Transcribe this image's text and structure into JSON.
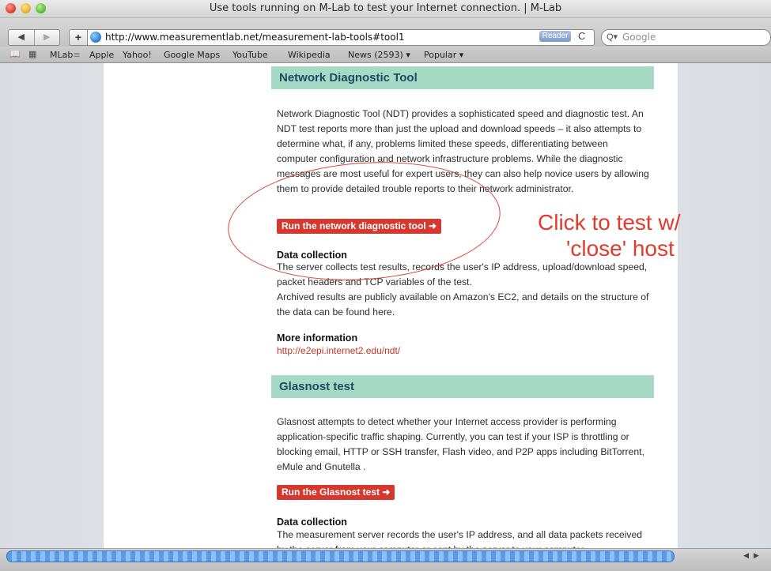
{
  "window": {
    "title": "Use tools running on M-Lab to test your Internet connection. | M-Lab"
  },
  "toolbar": {
    "back_icon": "◀",
    "forward_icon": "▶",
    "add_icon": "+",
    "url": "http://www.measurementlab.net/measurement-lab-tools#tool1",
    "reader_label": "Reader",
    "reload_icon": "C",
    "search_icon": "Q▾",
    "search_placeholder": "Google"
  },
  "bookmarks": {
    "items": [
      "MLab",
      "Apple",
      "Yahoo!",
      "Google Maps",
      "YouTube",
      "Wikipedia",
      "News (2593)",
      "Popular"
    ],
    "mlab_sep": "≡",
    "news_suffix": "▾",
    "popular_suffix": "▾"
  },
  "ndt": {
    "heading": "Network Diagnostic Tool",
    "paragraph": "Network Diagnostic Tool (NDT) provides a sophisticated speed and diagnostic test. An NDT test reports more than just the upload and download speeds – it also attempts to determine what, if any, problems limited these speeds, differentiating between computer configuration and network infrastructure problems. While the diagnostic messages are most useful for expert users, they can also help novice users by allowing them to provide detailed trouble reports to their network administrator.",
    "button": "Run the network diagnostic tool ➜",
    "data_collection_heading": "Data collection",
    "data_collection_text": "The server collects test results, records the user's IP address, upload/download speed, packet headers and TCP variables of the test.",
    "archive_text": "Archived results are publicly available on Amazon's EC2, and details on the structure of the data can be found here.",
    "more_info_heading": "More information",
    "more_info_link": "http://e2epi.internet2.edu/ndt/"
  },
  "glasnost": {
    "heading": "Glasnost test",
    "paragraph": "Glasnost attempts to detect whether your Internet access provider is performing application-specific traffic shaping. Currently, you can test if your ISP is throttling or blocking email, HTTP or SSH transfer, Flash video, and P2P apps including BitTorrent, eMule and Gnutella .",
    "button": "Run the Glasnost test ➜",
    "data_collection_heading": "Data collection",
    "data_collection_text": "The measurement server records the user's IP address, and all data packets received by the server from your computer or sent by the server to your computer"
  },
  "annotation": {
    "line1": "Click to test w/",
    "line2": "'close' host"
  },
  "statusbar": {
    "scroll_left": "◀",
    "scroll_right": "▶"
  }
}
